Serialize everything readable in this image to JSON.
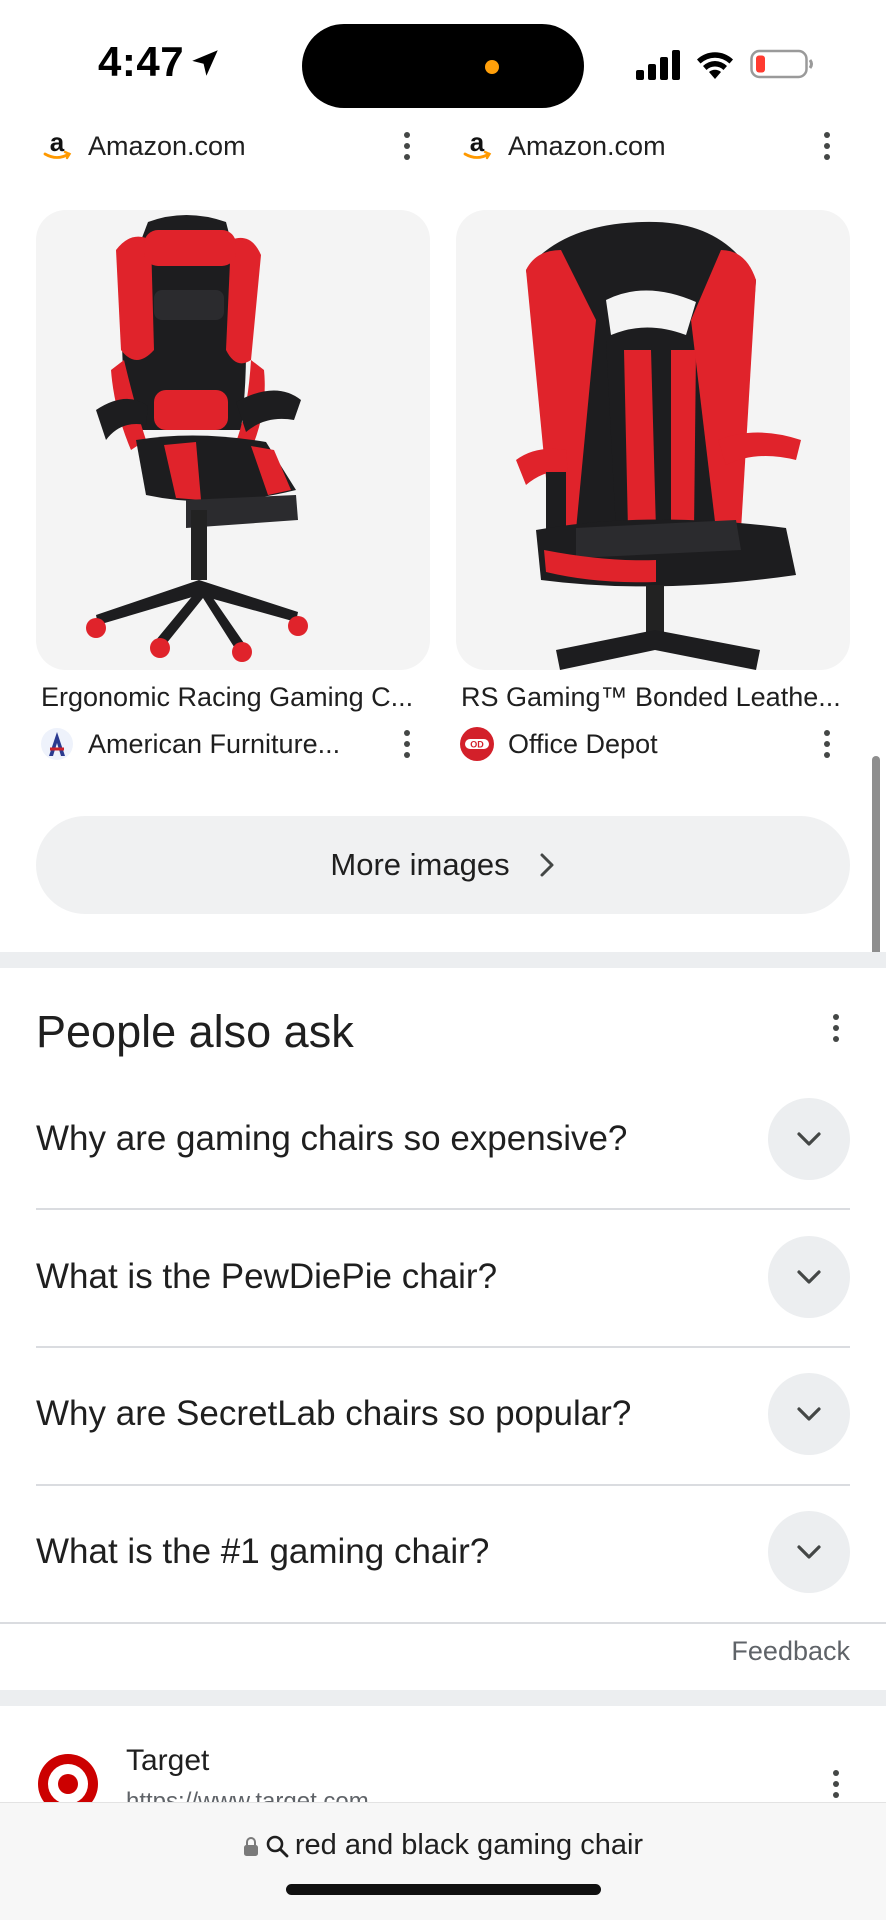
{
  "status_bar": {
    "time": "4:47"
  },
  "image_results": [
    {
      "source": "Amazon.com",
      "source_icon": "amazon-logo",
      "image_alt": "red-black racing gaming chair with footrest",
      "title": "",
      "title_source": "",
      "title_source_icon": ""
    },
    {
      "source": "Amazon.com",
      "source_icon": "amazon-logo",
      "image_alt": "red-black RS gaming chair",
      "title": "",
      "title_source": "",
      "title_source_icon": ""
    }
  ],
  "image_captions": [
    {
      "title": "Ergonomic Racing Gaming C...",
      "source": "American Furniture...",
      "source_icon": "american-furniture-logo"
    },
    {
      "title": "RS Gaming™ Bonded Leathe...",
      "source": "Office Depot",
      "source_icon": "office-depot-logo"
    }
  ],
  "more_images": {
    "label": "More images"
  },
  "people_also_ask": {
    "heading": "People also ask",
    "questions": [
      "Why are gaming chairs so expensive?",
      "What is the PewDiePie chair?",
      "Why are SecretLab chairs so popular?",
      "What is the #1 gaming chair?"
    ],
    "feedback": "Feedback"
  },
  "next_result": {
    "site_name": "Target",
    "url_partial": "https://www.target.com"
  },
  "address_bar": {
    "query": "red and black gaming chair"
  },
  "colors": {
    "chair_red": "#e0232b",
    "chair_black": "#1d1d1f",
    "target_red": "#cc0000",
    "office_depot_red": "#d3202a",
    "battery_low": "#ff3b30"
  }
}
